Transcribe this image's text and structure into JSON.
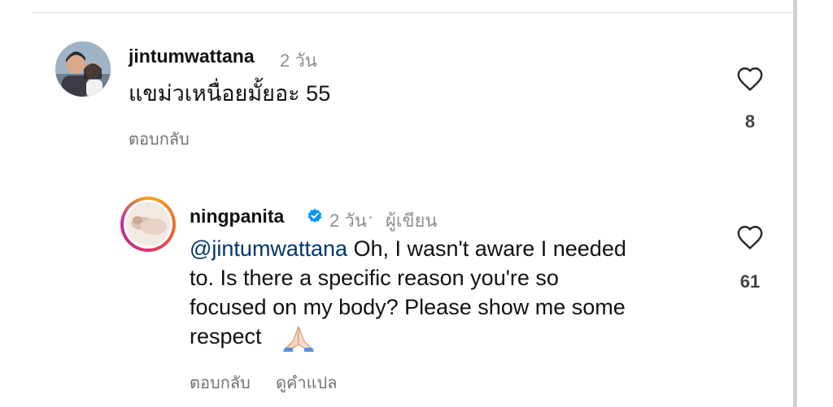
{
  "comments": [
    {
      "username": "jintumwattana",
      "time": "2 วัน",
      "text": "แขม่วเหนื่อยมั้ยอะ 55",
      "reply_label": "ตอบกลับ",
      "like_count": "8"
    },
    {
      "username": "ningpanita",
      "time": "2 วัน",
      "author_label": "ผู้เขียน",
      "mention": "@jintumwattana",
      "text_lines": [
        " Oh, I wasn't aware I needed",
        "to.  Is there a specific reason you're so",
        "focused on my body? Please show me some",
        "respect"
      ],
      "emoji": "🙏🏻",
      "reply_label": "ตอบกลับ",
      "translate_label": "ดูคำแปล",
      "like_count": "61"
    }
  ],
  "icons": {
    "like": "heart-outline-icon",
    "verified": "verified-badge-icon"
  },
  "colors": {
    "verified": "#0095f6",
    "mention": "#00376b",
    "secondary_text": "#8e8e8e"
  }
}
